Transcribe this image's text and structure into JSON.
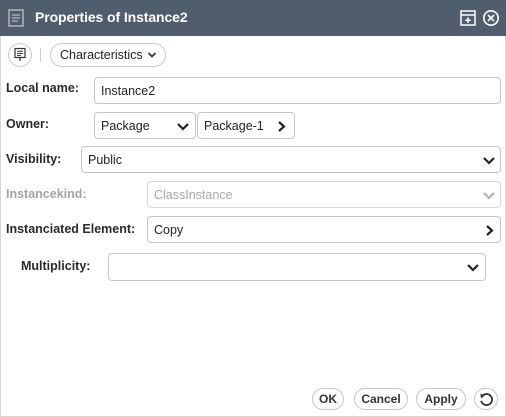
{
  "window": {
    "title": "Properties of Instance2"
  },
  "toolbar": {
    "view_label": "Characteristics"
  },
  "form": {
    "local_name": {
      "label": "Local name:",
      "value": "Instance2"
    },
    "owner": {
      "label": "Owner:",
      "type_value": "Package",
      "ref_value": "Package-1"
    },
    "visibility": {
      "label": "Visibility:",
      "value": "Public"
    },
    "instancekind": {
      "label": "Instancekind:",
      "value": "ClassInstance",
      "disabled": true
    },
    "instanciated_element": {
      "label": "Instanciated Element:",
      "value": "Copy"
    },
    "multiplicity": {
      "label": "Multiplicity:",
      "value": ""
    }
  },
  "buttons": {
    "ok": "OK",
    "cancel": "Cancel",
    "apply": "Apply"
  },
  "icons": {
    "title": "document-icon",
    "maximize": "maximize-icon",
    "close": "close-icon",
    "tool": "note-icon",
    "reset": "reset-icon"
  },
  "colors": {
    "titlebar": "#505d6d",
    "text": "#222222",
    "disabled": "#a8a8a8"
  }
}
